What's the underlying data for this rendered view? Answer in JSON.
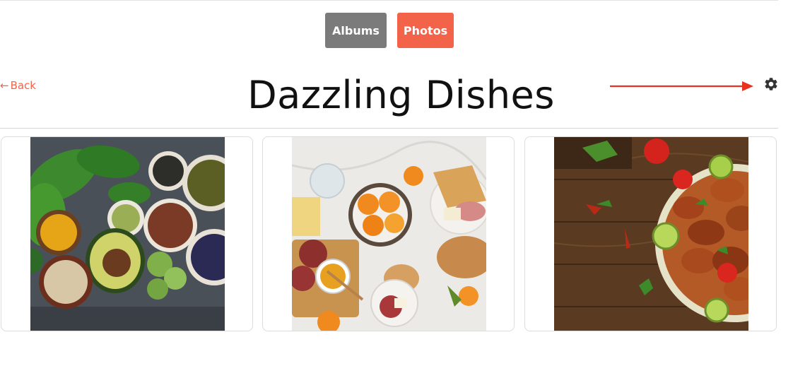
{
  "tabs": {
    "albums_label": "Albums",
    "photos_label": "Photos"
  },
  "nav": {
    "back_label": "Back"
  },
  "album": {
    "title": "Dazzling Dishes"
  },
  "icons": {
    "back": "arrow-left-icon",
    "settings": "gear-icon",
    "annotation": "red-arrow-icon"
  },
  "colors": {
    "accent": "#f2634a",
    "albums_button": "#7b7b7b",
    "annotation_arrow": "#e8321f"
  },
  "photos": [
    {
      "subject": "healthy ingredients bowls"
    },
    {
      "subject": "charcuterie and fruit spread"
    },
    {
      "subject": "grilled chicken wings bowl"
    }
  ]
}
